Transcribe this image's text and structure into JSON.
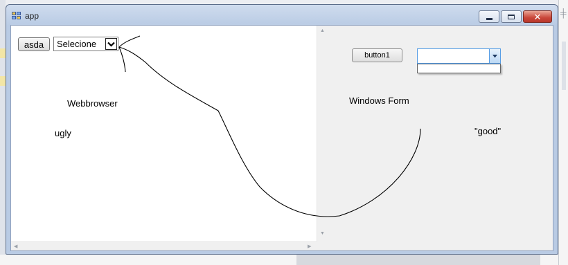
{
  "window": {
    "title": "app"
  },
  "webbrowser": {
    "button_label": "asda",
    "select_value": "Selecione",
    "label_name": "Webbrowser",
    "label_verdict": "ugly"
  },
  "windows_form": {
    "button_label": "button1",
    "combo_value": "",
    "label_name": "Windows Form",
    "label_verdict": "\"good\""
  },
  "icons": [
    "app-icon",
    "minimize-icon",
    "maximize-icon",
    "close-icon",
    "chevron-down-icon",
    "scroll-arrow-icon"
  ],
  "colors": {
    "titlebar": "#b9cbe4",
    "close_button": "#c9473a",
    "combo_focus_border": "#569de5"
  }
}
